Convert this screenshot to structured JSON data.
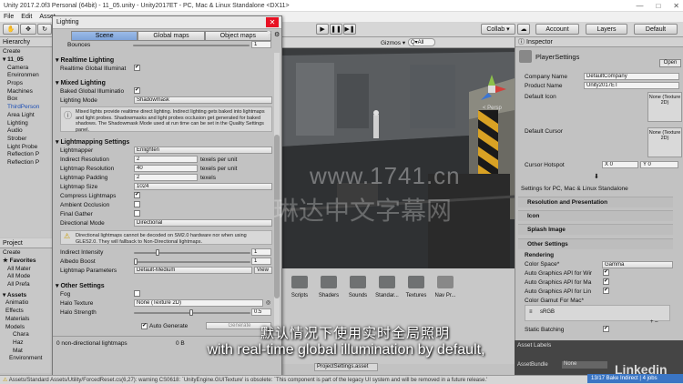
{
  "window": {
    "title": "Unity 2017.2.0f3 Personal (64bit) - 11_05.unity - Unity2017ET - PC, Mac & Linux Standalone <DX11>"
  },
  "menu": [
    "File",
    "Edit",
    "Asset"
  ],
  "toolbar": {
    "collab": "Collab ▾",
    "account": "Account",
    "layers": "Layers",
    "layout": "Default"
  },
  "hierarchy": {
    "title": "Hierarchy",
    "create": "Create",
    "scene": "11_05",
    "items": [
      "Camera",
      "Environmen",
      "Props",
      "Machines",
      "Box",
      "ThirdPerson",
      "Area Light",
      "Lighting",
      "Audio",
      "Strober",
      "Light Probe",
      "Reflection P",
      "Reflection P"
    ]
  },
  "project": {
    "title": "Project",
    "create": "Create",
    "favorites": "Favorites",
    "fav_items": [
      "All Mater",
      "All Mode",
      "All Prefa"
    ],
    "assets": "Assets",
    "asset_items": [
      "Animatio",
      "Effects",
      "Materials",
      "Models",
      "Chara",
      "Haz",
      "Mat",
      "Environment"
    ]
  },
  "lighting": {
    "title": "Lighting",
    "tabs": [
      "Scene",
      "Global maps",
      "Object maps"
    ],
    "bounces_label": "Bounces",
    "bounces_value": "1",
    "realtime": {
      "header": "Realtime Lighting",
      "gi_label": "Realtime Global Illuminat",
      "gi_checked": "✔"
    },
    "mixed": {
      "header": "Mixed Lighting",
      "baked_label": "Baked Global Illuminatio",
      "baked_checked": "✔",
      "mode_label": "Lighting Mode",
      "mode_value": "Shadowmask",
      "help": "Mixed lights provide realtime direct lighting. Indirect lighting gets baked into lightmaps and light probes. Shadowmasks and light probes occlusion get generated for baked shadows. The Shadowmask Mode used at run time can be set in the Quality Settings panel."
    },
    "lightmapping": {
      "header": "Lightmapping Settings",
      "rows": [
        {
          "label": "Lightmapper",
          "value": "Enlighten"
        },
        {
          "label": "Indirect Resolution",
          "value": "2",
          "unit": "texels per unit"
        },
        {
          "label": "Lightmap Resolution",
          "value": "40",
          "unit": "texels per unit"
        },
        {
          "label": "Lightmap Padding",
          "value": "2",
          "unit": "texels"
        },
        {
          "label": "Lightmap Size",
          "value": "1024"
        },
        {
          "label": "Compress Lightmaps",
          "value": "✔"
        },
        {
          "label": "Ambient Occlusion",
          "value": ""
        },
        {
          "label": "Final Gather",
          "value": ""
        },
        {
          "label": "Directional Mode",
          "value": "Directional"
        }
      ],
      "warning": "Directional lightmaps cannot be decoded on SM2.0 hardware nor when using GLES2.0. They will fallback to Non-Directional lightmaps.",
      "indirect_intensity_label": "Indirect Intensity",
      "indirect_intensity_value": "1",
      "albedo_boost_label": "Albedo Boost",
      "albedo_boost_value": "1",
      "params_label": "Lightmap Parameters",
      "params_value": "Default-Medium",
      "view": "View"
    },
    "other": {
      "header": "Other Settings",
      "fog_label": "Fog",
      "halo_texture_label": "Halo Texture",
      "halo_texture_value": "None (Texture 2D)",
      "halo_strength_label": "Halo Strength",
      "halo_strength_value": "0.5"
    },
    "auto_generate": "Auto Generate",
    "auto_checked": "✔",
    "generate_button": "Generate",
    "lightmaps_info": "0 non-directional lightmaps",
    "lightmaps_size": "0 B"
  },
  "scene": {
    "gizmos": "Gizmos ▾",
    "search": "Q▾All",
    "persp": "< Persp"
  },
  "assets_grid": [
    "Scripts",
    "Shaders",
    "Sounds",
    "Standar...",
    "Textures",
    "Nav Pr..."
  ],
  "asset_path": "ProjectSettings.asset",
  "inspector": {
    "title": "Inspector",
    "object": "PlayerSettings",
    "open": "Open",
    "rows": [
      {
        "label": "Company Name",
        "value": "DefaultCompany"
      },
      {
        "label": "Product Name",
        "value": "Unity2017ET"
      }
    ],
    "default_icon": "Default Icon",
    "default_cursor": "Default Cursor",
    "none_texture": "None (Texture 2D)",
    "select": "Select",
    "cursor_hotspot": "Cursor Hotspot",
    "hotspot_x": "X 0",
    "hotspot_y": "Y 0",
    "settings_for": "Settings for PC, Mac & Linux Standalone",
    "sections": [
      "Resolution and Presentation",
      "Icon",
      "Splash Image",
      "Other Settings"
    ],
    "rendering": "Rendering",
    "color_space_label": "Color Space*",
    "color_space_value": "Gamma",
    "auto_api": [
      "Auto Graphics API for Wir",
      "Auto Graphics API for Ma",
      "Auto Graphics API for Lin"
    ],
    "gamut_label": "Color Gamut For Mac*",
    "gamut_value": "sRGB",
    "static_batching": "Static Batching",
    "asset_labels": "Asset Labels",
    "assetbundle": "AssetBundle",
    "assetbundle_value": "None"
  },
  "status": "Assets/Standard Assets/Utility/ForcedReset.cs(6,27): warning CS0618: `UnityEngine.GUITexture' is obsolete: `This component is part of the legacy UI system and will be removed in a future release.'",
  "bake_status": "13/17 Bake Indirect | 4 jobs",
  "watermark": {
    "url": "www.1741.cn",
    "cn": "琳达中文字幕网"
  },
  "linkedin": "Linkedin",
  "subtitle": {
    "cn": "默认情况下使用实时全局照明",
    "en": "with real-time global illumination by default,"
  }
}
